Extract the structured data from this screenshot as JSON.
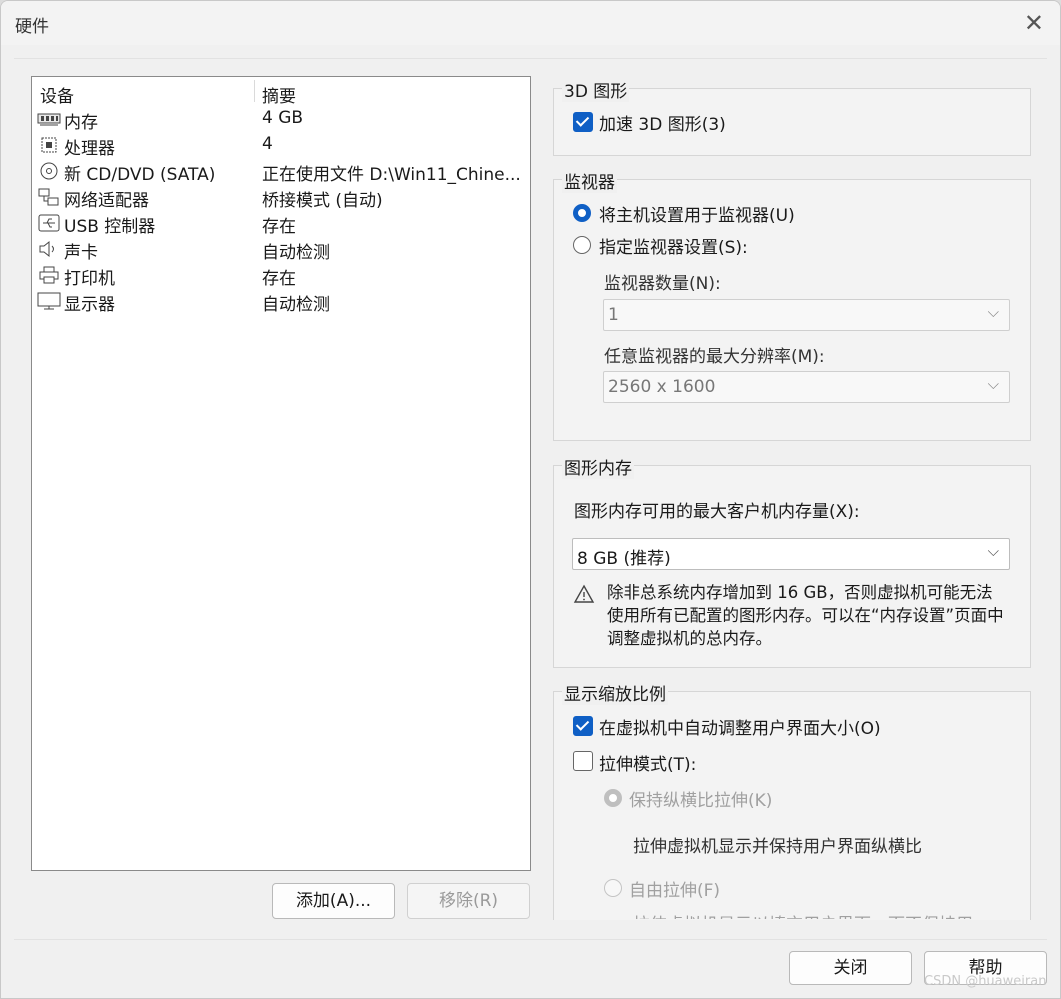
{
  "window": {
    "title": "硬件"
  },
  "device_list": {
    "headers": [
      "设备",
      "摘要"
    ],
    "rows": [
      {
        "icon": "memory-icon",
        "name": "内存",
        "summary": "4 GB"
      },
      {
        "icon": "processor-icon",
        "name": "处理器",
        "summary": "4"
      },
      {
        "icon": "cd-dvd-icon",
        "name": "新 CD/DVD (SATA)",
        "summary": "正在使用文件 D:\\Win11_Chine..."
      },
      {
        "icon": "network-adapter-icon",
        "name": "网络适配器",
        "summary": "桥接模式 (自动)"
      },
      {
        "icon": "usb-icon",
        "name": "USB 控制器",
        "summary": "存在"
      },
      {
        "icon": "sound-card-icon",
        "name": "声卡",
        "summary": "自动检测"
      },
      {
        "icon": "printer-icon",
        "name": "打印机",
        "summary": "存在"
      },
      {
        "icon": "display-icon",
        "name": "显示器",
        "summary": "自动检测"
      }
    ],
    "add_button": "添加(A)...",
    "remove_button": "移除(R)"
  },
  "graphics_3d": {
    "title": "3D 图形",
    "accelerate_label": "加速 3D 图形(3)",
    "accelerate_checked": true
  },
  "monitor": {
    "title": "监视器",
    "use_host_label": "将主机设置用于监视器(U)",
    "specify_label": "指定监视器设置(S):",
    "selected": "use_host",
    "count_label": "监视器数量(N):",
    "count_value": "1",
    "max_res_label": "任意监视器的最大分辨率(M):",
    "max_res_value": "2560 x 1600"
  },
  "graphics_memory": {
    "title": "图形内存",
    "max_label": "图形内存可用的最大客户机内存量(X):",
    "value": "8 GB (推荐)",
    "warning": "除非总系统内存增加到 16 GB，否则虚拟机可能无法使用所有已配置的图形内存。可以在“内存设置”页面中调整虚拟机的总内存。"
  },
  "display_scaling": {
    "title": "显示缩放比例",
    "auto_adjust_label": "在虚拟机中自动调整用户界面大小(O)",
    "auto_adjust_checked": true,
    "stretch_label": "拉伸模式(T):",
    "stretch_checked": false,
    "keep_aspect_label": "保持纵横比拉伸(K)",
    "keep_aspect_desc": "拉伸虚拟机显示并保持用户界面纵横比",
    "free_stretch_label": "自由拉伸(F)",
    "free_stretch_desc": "拉伸虚拟机显示以填充用户界面，而不保持用"
  },
  "footer": {
    "close_button": "关闭",
    "help_button": "帮助"
  },
  "watermark": "CSDN @huaweiran",
  "colors": {
    "accent": "#0f5fc5",
    "window_bg": "#f0f0f0",
    "list_bg": "#ffffff"
  }
}
